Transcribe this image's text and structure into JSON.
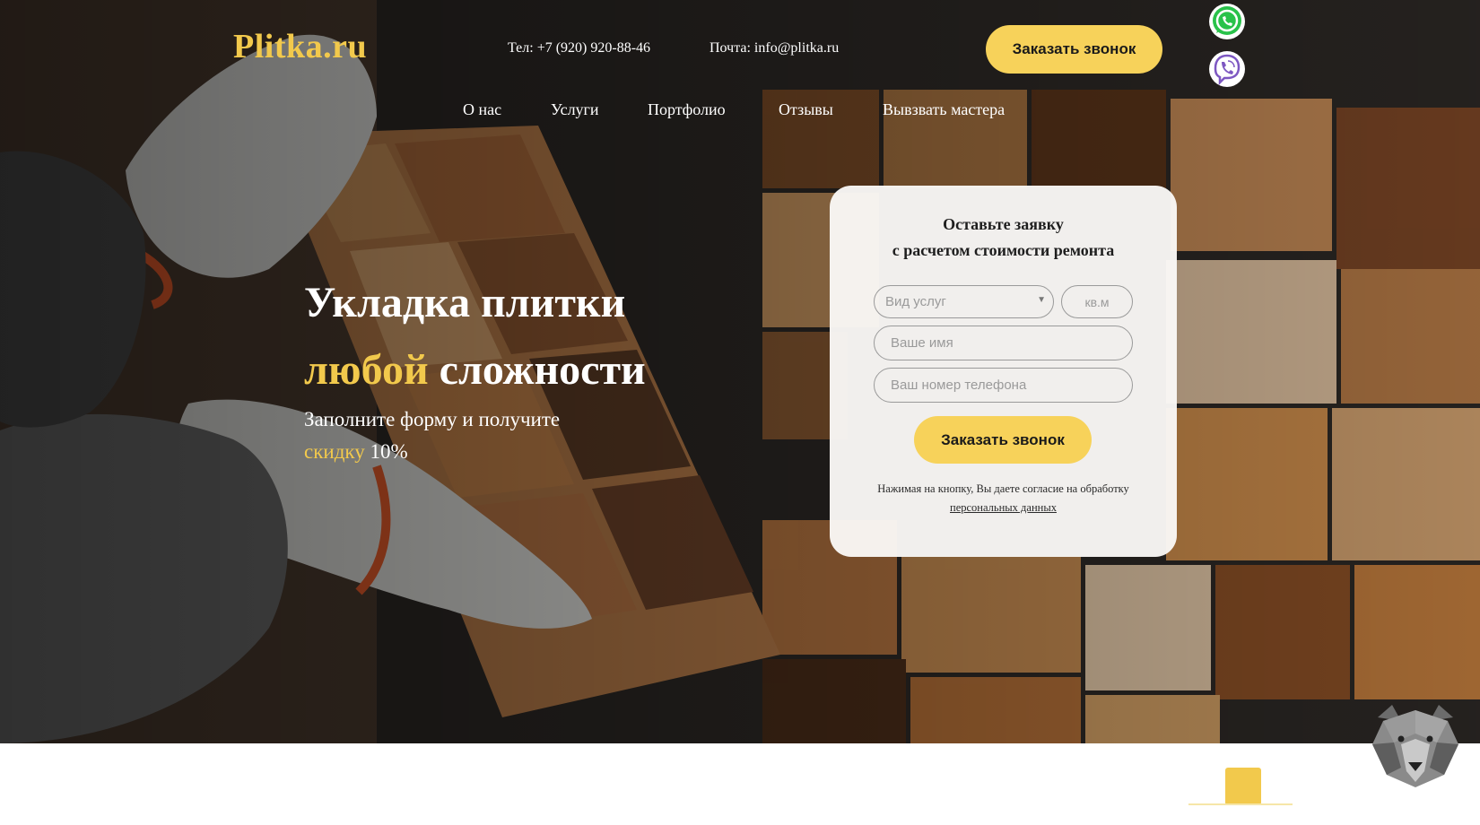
{
  "header": {
    "logo": "Plitka.ru",
    "phone": "Тел: +7 (920) 920-88-46",
    "email": "Почта: info@plitka.ru",
    "cta_label": "Заказать звонок"
  },
  "messengers": [
    {
      "name": "whatsapp-icon"
    },
    {
      "name": "viber-icon"
    }
  ],
  "nav": {
    "items": [
      {
        "label": "О нас"
      },
      {
        "label": "Услуги"
      },
      {
        "label": "Портфолио"
      },
      {
        "label": "Отзывы"
      },
      {
        "label": "Вывзвать мастера"
      }
    ]
  },
  "hero": {
    "title_line1": "Укладка плитки",
    "title_accent": "любой",
    "title_line2_rest": "сложности",
    "sub_line1": "Заполните форму и получите",
    "sub_accent": "скидку",
    "sub_rest": "10%"
  },
  "form": {
    "title_line1": "Оставьте заявку",
    "title_line2": "с расчетом стоимости ремонта",
    "service_select": "Вид услуг",
    "sqm_placeholder": "кв.м",
    "name_placeholder": "Ваше имя",
    "phone_placeholder": "Ваш номер телефона",
    "submit_label": "Заказать звонок",
    "consent_text": "Нажимая на кнопку, Вы даете согласие на обработку",
    "consent_link": "персональных данных"
  },
  "colors": {
    "accent": "#f2c94c",
    "button": "#f7d25a"
  }
}
